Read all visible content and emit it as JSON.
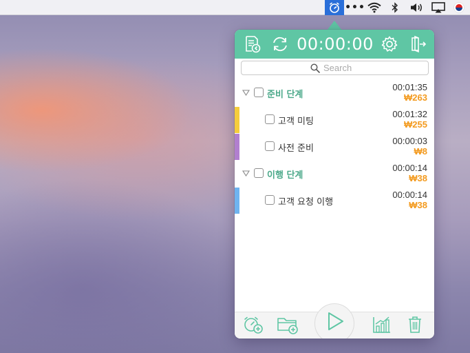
{
  "menubar": {
    "items": [
      {
        "icon": "timer-icon"
      },
      {
        "icon": "more-dots-icon",
        "text": "•••"
      },
      {
        "icon": "wifi-icon"
      },
      {
        "icon": "bluetooth-icon"
      },
      {
        "icon": "volume-icon"
      },
      {
        "icon": "airplay-icon"
      },
      {
        "icon": "korea-flag-icon"
      }
    ]
  },
  "toolbar": {
    "timer": "00:00:00",
    "icons": [
      "report-icon",
      "sync-icon",
      "gear-icon",
      "exit-icon"
    ]
  },
  "search": {
    "placeholder": "Search"
  },
  "tasks": [
    {
      "label": "준비 단계",
      "time": "00:01:35",
      "cost": "₩263",
      "type": "group",
      "color": ""
    },
    {
      "label": "고객 미팅",
      "time": "00:01:32",
      "cost": "₩255",
      "type": "task",
      "color": "#f5cd3c"
    },
    {
      "label": "사전 준비",
      "time": "00:00:03",
      "cost": "₩8",
      "type": "task",
      "color": "#b17fcf"
    },
    {
      "label": "이행 단계",
      "time": "00:00:14",
      "cost": "₩38",
      "type": "group",
      "color": ""
    },
    {
      "label": "고객 요청 이행",
      "time": "00:00:14",
      "cost": "₩38",
      "type": "task",
      "color": "#6fb4f0"
    }
  ],
  "footer": {
    "icons": [
      "add-timer-icon",
      "add-folder-icon",
      "play-icon",
      "stats-icon",
      "trash-icon"
    ]
  },
  "colors": {
    "accent": "#5fc6a4",
    "cost": "#f39a1e",
    "group_label": "#4aa889"
  }
}
